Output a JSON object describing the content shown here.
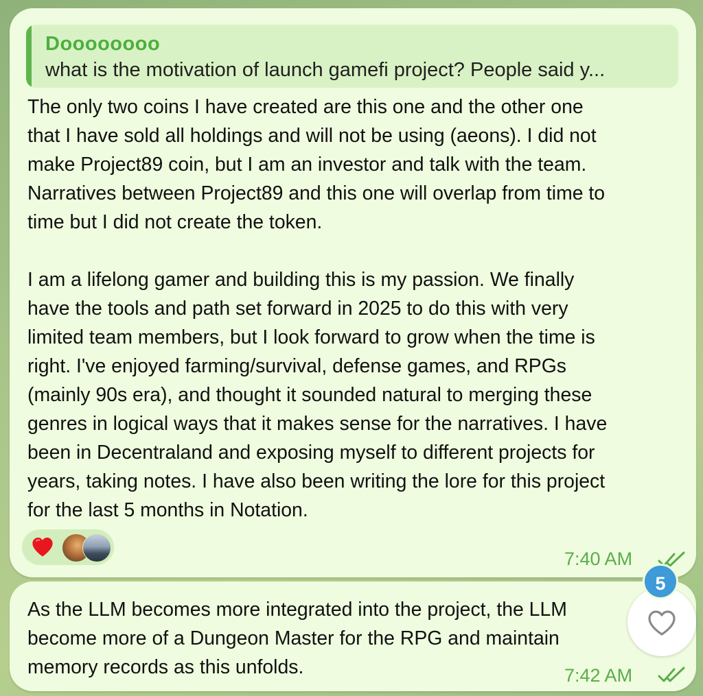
{
  "messages": [
    {
      "reply": {
        "name": "Doooooooo",
        "text": "what is the motivation of launch gamefi project? People said y..."
      },
      "text": "The only two coins I have created are this one and the other one\nthat I have sold all holdings and will not be using (aeons). I did not\nmake Project89 coin, but I am an investor and talk with the team.\nNarratives between Project89 and this one will overlap from time to\ntime but I did not create the token.\n\nI am a lifelong gamer and building this is my passion. We finally\nhave the tools and path set forward in 2025 to do this with very\nlimited team members, but I look forward to grow when the time is\nright. I've enjoyed farming/survival, defense games, and RPGs\n(mainly 90s era), and thought it sounded natural to merging these\ngenres in logical ways that it makes sense for the narratives. I have\nbeen in Decentraland and exposing myself to different projects for\nyears, taking notes. I have also been writing the lore for this project\nfor the last 5 months in Notation.",
      "reactions": {
        "emoji": "heart-icon",
        "users": [
          "avatar-1",
          "avatar-2"
        ]
      },
      "time": "7:40 AM",
      "status": "double-check-icon"
    },
    {
      "text": "As the LLM becomes more integrated into the project, the LLM\nbecome more of a Dungeon Master for the RPG and maintain\nmemory records as this unfolds.",
      "time": "7:42 AM",
      "status": "double-check-icon"
    }
  ],
  "like_button": {
    "icon": "heart-outline-icon",
    "badge_count": "5"
  },
  "colors": {
    "bubble": "#effcdf",
    "accent": "#4caf3d",
    "badge": "#3e9ad8"
  }
}
